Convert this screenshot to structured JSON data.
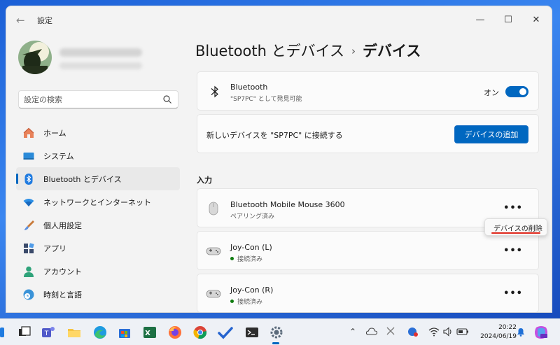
{
  "window": {
    "title": "設定",
    "controls": {
      "minimize": "—",
      "maximize": "☐",
      "close": "✕"
    },
    "back_glyph": "←"
  },
  "search": {
    "placeholder": "設定の検索"
  },
  "sidebar": {
    "items": [
      {
        "label": "ホーム",
        "icon": "home-icon",
        "active": false
      },
      {
        "label": "システム",
        "icon": "system-icon",
        "active": false
      },
      {
        "label": "Bluetooth とデバイス",
        "icon": "bluetooth-icon",
        "active": true
      },
      {
        "label": "ネットワークとインターネット",
        "icon": "wifi-icon",
        "active": false
      },
      {
        "label": "個人用設定",
        "icon": "brush-icon",
        "active": false
      },
      {
        "label": "アプリ",
        "icon": "apps-icon",
        "active": false
      },
      {
        "label": "アカウント",
        "icon": "account-icon",
        "active": false
      },
      {
        "label": "時刻と言語",
        "icon": "time-language-icon",
        "active": false
      }
    ]
  },
  "breadcrumb": {
    "parent": "Bluetooth とデバイス",
    "separator": "›",
    "current": "デバイス"
  },
  "bluetooth_card": {
    "title": "Bluetooth",
    "subtitle": "\"SP7PC\" として発見可能",
    "toggle_label": "オン",
    "toggle_on": true
  },
  "add_card": {
    "text": "新しいデバイスを \"SP7PC\" に接続する",
    "button_label": "デバイスの追加"
  },
  "input_section": {
    "label": "入力",
    "devices": [
      {
        "name": "Bluetooth Mobile Mouse 3600",
        "status": "ペアリング済み",
        "connected": false,
        "icon": "mouse-icon",
        "more": "•••"
      },
      {
        "name": "Joy-Con (L)",
        "status": "接続済み",
        "connected": true,
        "icon": "gamepad-icon",
        "more": "•••"
      },
      {
        "name": "Joy-Con (R)",
        "status": "接続済み",
        "connected": true,
        "icon": "gamepad-icon",
        "more": "•••"
      }
    ]
  },
  "context_menu": {
    "item": "デバイスの削除"
  },
  "taskbar": {
    "time": "20:22",
    "date": "2024/06/19",
    "apps": [
      "start",
      "task-view",
      "teams",
      "file-explorer",
      "edge",
      "store",
      "excel",
      "firefox",
      "chrome",
      "todo",
      "terminal",
      "settings"
    ]
  },
  "colors": {
    "accent": "#0067c0",
    "connected_dot": "#0f7b0f",
    "highlight": "#e0291d"
  }
}
